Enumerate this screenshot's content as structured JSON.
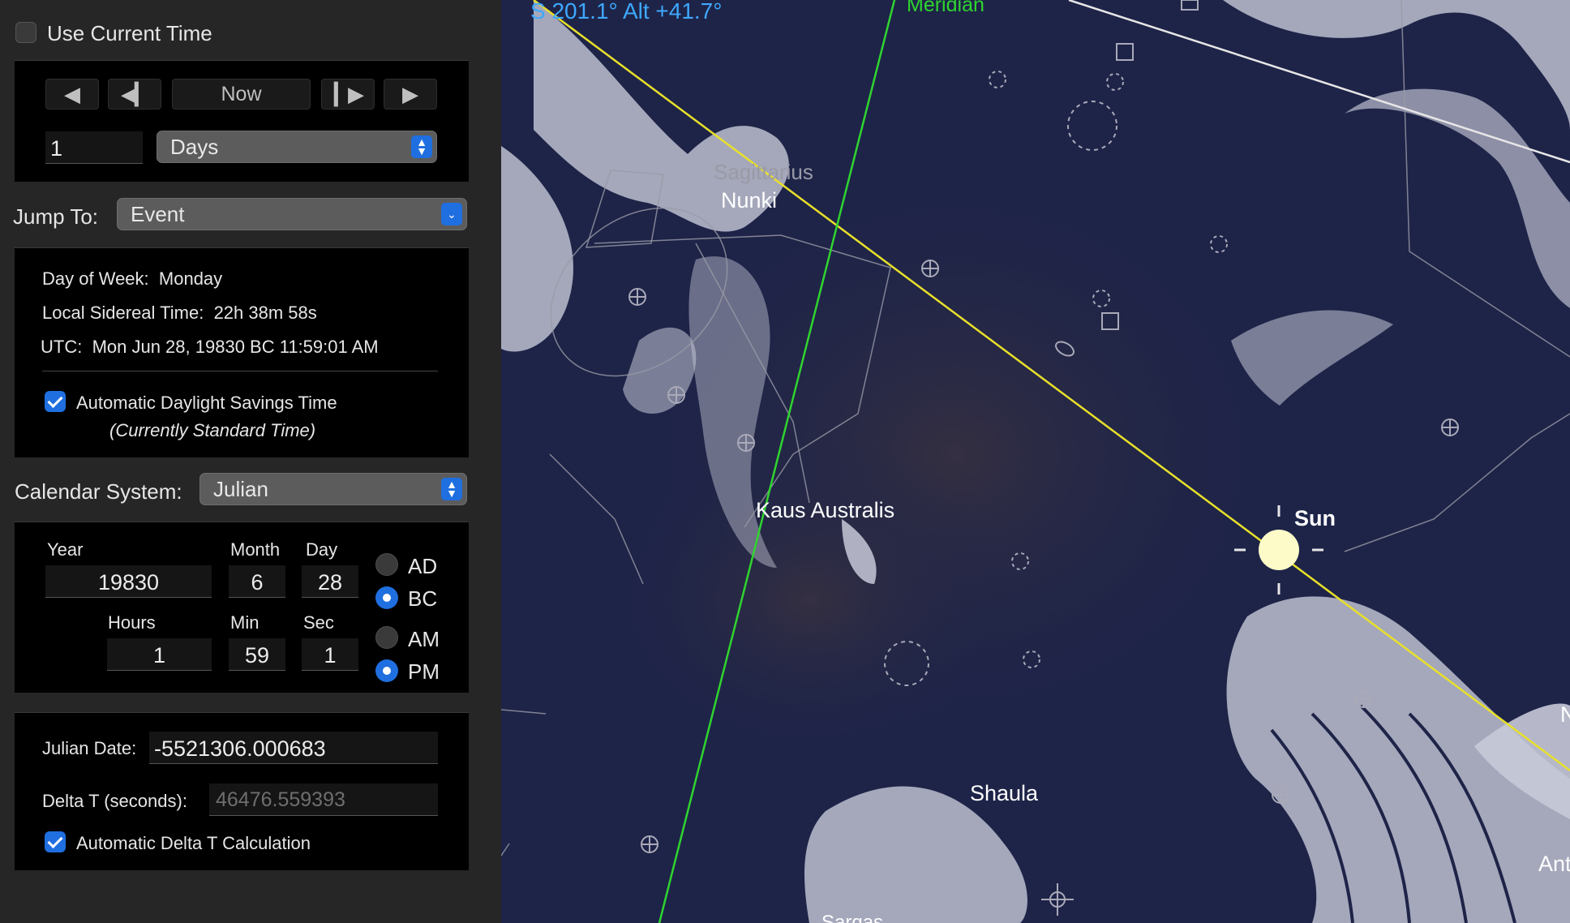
{
  "time_controls": {
    "use_current_time_label": "Use Current Time",
    "use_current_time_checked": false,
    "now_label": "Now",
    "step_amount": "1",
    "step_unit": "Days"
  },
  "jump_to": {
    "label": "Jump To:",
    "value": "Event"
  },
  "info": {
    "day_of_week_label": "Day of Week:",
    "day_of_week": "Monday",
    "lst_label": "Local Sidereal Time:",
    "lst": "22h 38m 58s",
    "utc_label": "UTC:",
    "utc": "Mon Jun 28, 19830 BC 11:59:01 AM",
    "dst_label": "Automatic Daylight Savings Time",
    "dst_checked": true,
    "dst_status": "(Currently Standard Time)"
  },
  "calendar": {
    "label": "Calendar System:",
    "value": "Julian"
  },
  "date": {
    "year_label": "Year",
    "year": "19830",
    "month_label": "Month",
    "month": "6",
    "day_label": "Day",
    "day": "28",
    "hours_label": "Hours",
    "hours": "1",
    "min_label": "Min",
    "min": "59",
    "sec_label": "Sec",
    "sec": "1",
    "era_ad": "AD",
    "era_bc": "BC",
    "era_selected": "BC",
    "am": "AM",
    "pm": "PM",
    "ampm_selected": "PM"
  },
  "julian": {
    "jd_label": "Julian Date:",
    "jd": "-5521306.000683",
    "delta_t_label": "Delta T (seconds):",
    "delta_t": "46476.559393",
    "auto_delta_t_label": "Automatic Delta T Calculation",
    "auto_delta_t_checked": true
  },
  "sky": {
    "pointer_readout": "S 201.1° Alt +41.7°",
    "meridian_label": "Meridian",
    "constellation": "Sagittarius",
    "stars": {
      "nunki": "Nunki",
      "kaus_australis": "Kaus Australis",
      "shaula": "Shaula",
      "partial_right": "Ant",
      "partial_bottom": "Sargas",
      "partial_edge": "N"
    },
    "sun_label": "Sun",
    "colors": {
      "ecliptic": "#e8e02a",
      "meridian": "#2fd42f",
      "readout": "#3ea8ff",
      "sun": "#fdfbc8",
      "sky": "#1e2448"
    }
  }
}
